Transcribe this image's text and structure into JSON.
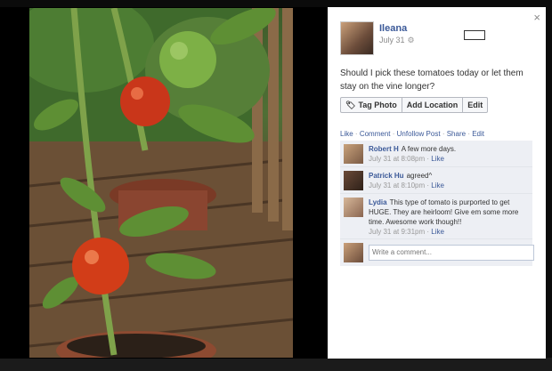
{
  "panel": {
    "author": "Ileana",
    "date": "July 31",
    "caption": "Should I pick these tomatoes today or let them stay on the vine longer?",
    "close_glyph": "×",
    "gear_glyph": "⚙",
    "actions": {
      "tag": "Tag Photo",
      "location": "Add Location",
      "edit": "Edit"
    },
    "story_links": {
      "like": "Like",
      "comment": "Comment",
      "unfollow": "Unfollow Post",
      "share": "Share",
      "edit": "Edit",
      "separator": "·"
    },
    "comments": [
      {
        "name": "Robert H",
        "text": "A few more days.",
        "time": "July 31 at 8:08pm",
        "like": "Like"
      },
      {
        "name": "Patrick Hu",
        "text": "agreed^",
        "time": "July 31 at 8:10pm",
        "like": "Like"
      },
      {
        "name": "Lydia",
        "text": "This type of tomato is purported to get HUGE. They are heirloom! Give em some more time. Awesome work though!!",
        "time": "July 31 at 9:31pm",
        "like": "Like"
      }
    ],
    "write_placeholder": "Write a comment..."
  },
  "colors": {
    "link": "#3b5998",
    "comment_bg": "#edeff4",
    "backdrop": "#0b0b0b"
  }
}
